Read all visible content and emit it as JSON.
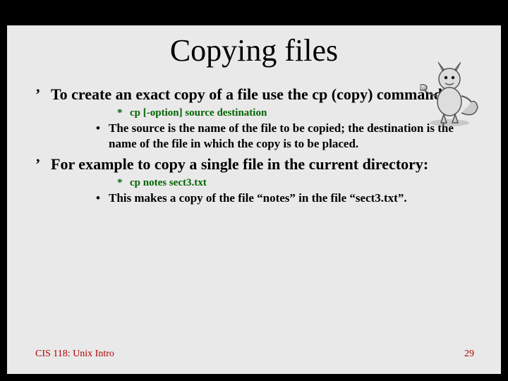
{
  "title": "Copying files",
  "bullets": {
    "b1": "To create an exact copy of a file use the cp (copy) command.",
    "b1a": "cp [-option] source destination",
    "b1b": "The source is the name of the file to be copied; the destination is the name of the file in which the copy is to be placed.",
    "b2": "For example to copy a single file in the current directory:",
    "b2a": "cp notes sect3.txt",
    "b2b": "This makes a copy of the file “notes” in the file “sect3.txt”."
  },
  "footer": {
    "left": "CIS 118: Unix Intro",
    "right": "29"
  },
  "icon_name": "bsd-daemon-mascot"
}
